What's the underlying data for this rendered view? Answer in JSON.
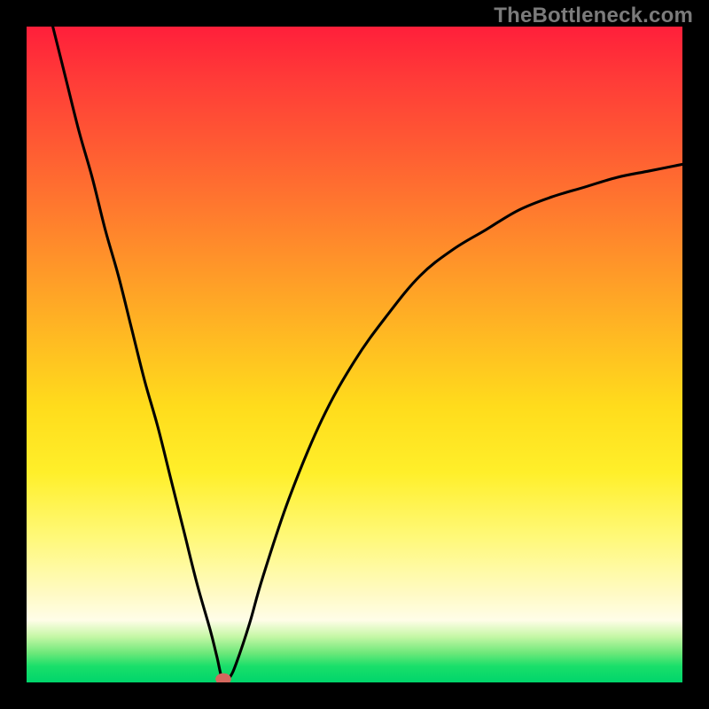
{
  "watermark": "TheBottleneck.com",
  "chart_data": {
    "type": "line",
    "title": "",
    "xlabel": "",
    "ylabel": "",
    "xlim": [
      0,
      100
    ],
    "ylim": [
      0,
      100
    ],
    "legend": false,
    "grid": false,
    "background_gradient": {
      "orientation": "vertical",
      "stops": [
        {
          "pos": 0.0,
          "color": "#ff1f3a"
        },
        {
          "pos": 0.18,
          "color": "#ff5a33"
        },
        {
          "pos": 0.38,
          "color": "#ff9b28"
        },
        {
          "pos": 0.58,
          "color": "#ffdc1c"
        },
        {
          "pos": 0.78,
          "color": "#fff97a"
        },
        {
          "pos": 0.905,
          "color": "#fffde8"
        },
        {
          "pos": 0.955,
          "color": "#6ee87a"
        },
        {
          "pos": 1.0,
          "color": "#00d56b"
        }
      ]
    },
    "dip_x": 30,
    "series": [
      {
        "name": "bottleneck-curve",
        "color": "#000000",
        "x": [
          4,
          6,
          8,
          10,
          12,
          14,
          16,
          18,
          20,
          22,
          24,
          26,
          28,
          29,
          30,
          31,
          32,
          34,
          36,
          40,
          45,
          50,
          55,
          60,
          65,
          70,
          75,
          80,
          85,
          90,
          95,
          100
        ],
        "y": [
          100,
          92,
          84,
          77,
          69,
          62,
          54,
          46,
          39,
          31,
          23,
          15,
          8,
          4,
          0,
          0.8,
          3,
          9,
          16,
          28,
          40,
          49,
          56,
          62,
          66,
          69,
          72,
          74,
          75.5,
          77,
          78,
          79
        ]
      }
    ],
    "markers": [
      {
        "name": "dip-dot",
        "x": 30,
        "y": 0.5,
        "color": "#d4685e",
        "rx": 1.2,
        "ry": 0.9
      }
    ]
  }
}
